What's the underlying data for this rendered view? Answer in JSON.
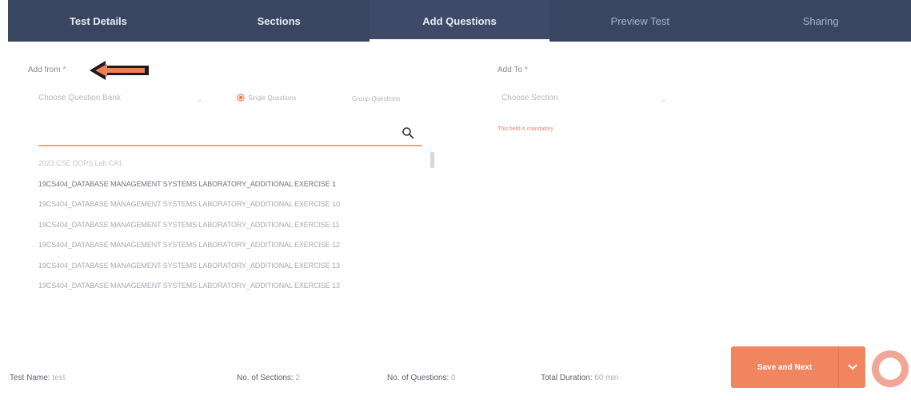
{
  "tabs": [
    {
      "label": "Test Details",
      "state": "done"
    },
    {
      "label": "Sections",
      "state": "done"
    },
    {
      "label": "Add Questions",
      "state": "active"
    },
    {
      "label": "Preview Test",
      "state": "inactive"
    },
    {
      "label": "Sharing",
      "state": "inactive"
    }
  ],
  "add_from": {
    "label": "Add from",
    "required_mark": "*",
    "bank_placeholder": "Choose Question Bank",
    "radio_single": "Single Questions",
    "radio_group": "Group Questions",
    "selected_radio": "Single Questions"
  },
  "add_to": {
    "label": "Add To",
    "required_mark": "*",
    "section_placeholder": "Choose Section",
    "validation": "This field is mandatory"
  },
  "search": {
    "placeholder": "",
    "value": ""
  },
  "question_banks": [
    "2023 CSE OOPS Lab CA1",
    "19CS404_DATABASE MANAGEMENT SYSTEMS LABORATORY_ADDITIONAL EXERCISE 1",
    "19CS404_DATABASE MANAGEMENT SYSTEMS LABORATORY_ADDITIONAL EXERCISE 10",
    "19CS404_DATABASE MANAGEMENT SYSTEMS LABORATORY_ADDITIONAL EXERCISE 11",
    "19CS404_DATABASE MANAGEMENT SYSTEMS LABORATORY_ADDITIONAL EXERCISE 12",
    "19CS404_DATABASE MANAGEMENT SYSTEMS LABORATORY_ADDITIONAL EXERCISE 13",
    "19CS404_DATABASE MANAGEMENT SYSTEMS LABORATORY_ADDITIONAL EXERCISE 13"
  ],
  "footer": {
    "test_name_label": "Test Name:",
    "test_name_value": "test",
    "sections_label": "No. of Sections:",
    "sections_value": "2",
    "questions_label": "No. of Questions:",
    "questions_value": "0",
    "duration_label": "Total Duration:",
    "duration_value": "60 min"
  },
  "save_button": {
    "label": "Save and Next"
  },
  "colors": {
    "nav_bg": "#3a4562",
    "accent": "#f08560",
    "validation": "#f0837a"
  },
  "icons": {
    "search": "search-icon",
    "arrow": "arrow-left-icon",
    "chevron": "chevron-down-icon",
    "chat": "chat-icon"
  }
}
